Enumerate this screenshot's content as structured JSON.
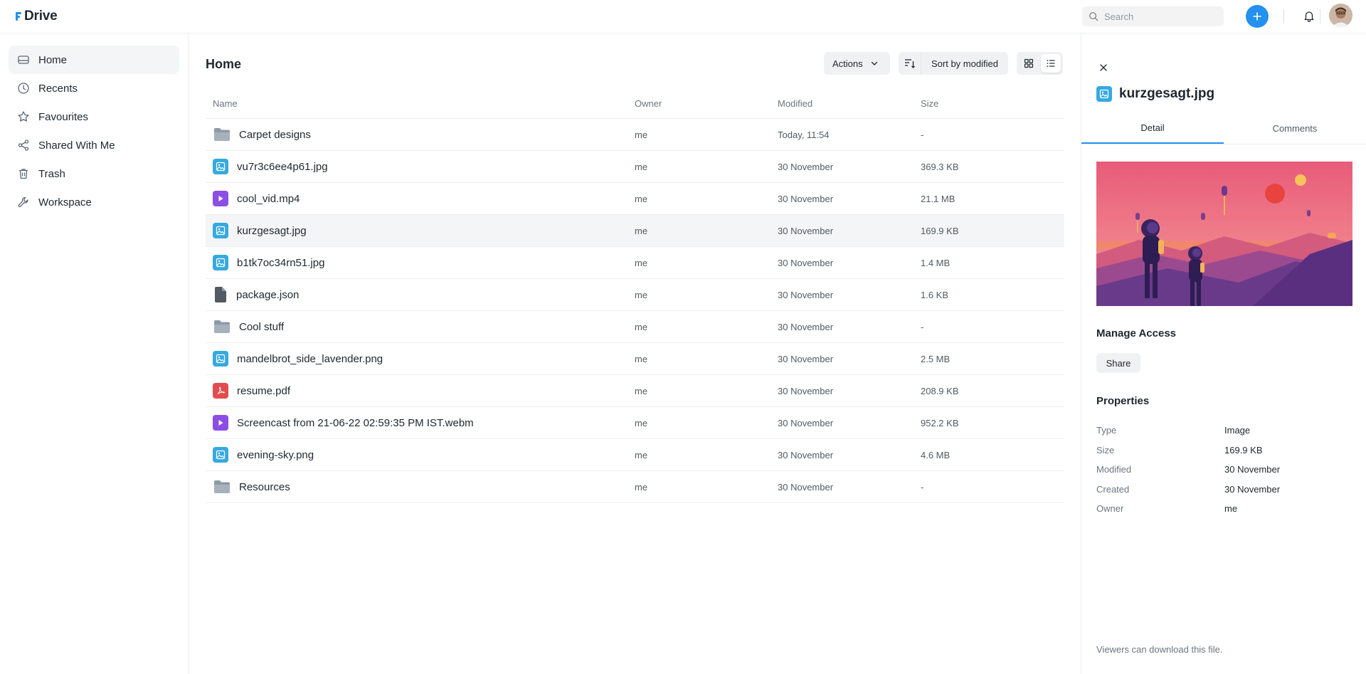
{
  "app": {
    "name": "Drive"
  },
  "search": {
    "placeholder": "Search"
  },
  "sidebar": {
    "items": [
      {
        "label": "Home",
        "icon": "drive-icon",
        "active": true
      },
      {
        "label": "Recents",
        "icon": "clock-icon"
      },
      {
        "label": "Favourites",
        "icon": "star-icon"
      },
      {
        "label": "Shared With Me",
        "icon": "share-icon"
      },
      {
        "label": "Trash",
        "icon": "trash-icon"
      },
      {
        "label": "Workspace",
        "icon": "wrench-icon"
      }
    ]
  },
  "main": {
    "title": "Home",
    "actions_label": "Actions",
    "sort_label": "Sort by modified",
    "columns": {
      "name": "Name",
      "owner": "Owner",
      "modified": "Modified",
      "size": "Size"
    },
    "files": [
      {
        "name": "Carpet designs",
        "type": "folder",
        "owner": "me",
        "modified": "Today, 11:54",
        "size": "-"
      },
      {
        "name": "vu7r3c6ee4p61.jpg",
        "type": "image",
        "owner": "me",
        "modified": "30 November",
        "size": "369.3 KB"
      },
      {
        "name": "cool_vid.mp4",
        "type": "video",
        "owner": "me",
        "modified": "30 November",
        "size": "21.1 MB"
      },
      {
        "name": "kurzgesagt.jpg",
        "type": "image",
        "owner": "me",
        "modified": "30 November",
        "size": "169.9 KB",
        "selected": true
      },
      {
        "name": "b1tk7oc34rn51.jpg",
        "type": "image",
        "owner": "me",
        "modified": "30 November",
        "size": "1.4 MB"
      },
      {
        "name": "package.json",
        "type": "doc",
        "owner": "me",
        "modified": "30 November",
        "size": "1.6 KB"
      },
      {
        "name": "Cool stuff",
        "type": "folder",
        "owner": "me",
        "modified": "30 November",
        "size": "-"
      },
      {
        "name": "mandelbrot_side_lavender.png",
        "type": "image",
        "owner": "me",
        "modified": "30 November",
        "size": "2.5 MB"
      },
      {
        "name": "resume.pdf",
        "type": "pdf",
        "owner": "me",
        "modified": "30 November",
        "size": "208.9 KB"
      },
      {
        "name": "Screencast from 21-06-22 02:59:35 PM IST.webm",
        "type": "video",
        "owner": "me",
        "modified": "30 November",
        "size": "952.2 KB"
      },
      {
        "name": "evening-sky.png",
        "type": "image",
        "owner": "me",
        "modified": "30 November",
        "size": "4.6 MB"
      },
      {
        "name": "Resources",
        "type": "folder",
        "owner": "me",
        "modified": "30 November",
        "size": "-"
      }
    ]
  },
  "panel": {
    "title": "kurzgesagt.jpg",
    "tabs": [
      "Detail",
      "Comments"
    ],
    "manage_access": "Manage Access",
    "share_label": "Share",
    "properties_title": "Properties",
    "properties": [
      {
        "key": "Type",
        "value": "Image"
      },
      {
        "key": "Size",
        "value": "169.9 KB"
      },
      {
        "key": "Modified",
        "value": "30 November"
      },
      {
        "key": "Created",
        "value": "30 November"
      },
      {
        "key": "Owner",
        "value": "me"
      }
    ],
    "footnote": "Viewers can download this file."
  },
  "colors": {
    "accent": "#2490ef",
    "image": "#36a9e1",
    "video": "#8c4ee5",
    "pdf": "#e24c4c",
    "folder": "#8d99a6"
  }
}
